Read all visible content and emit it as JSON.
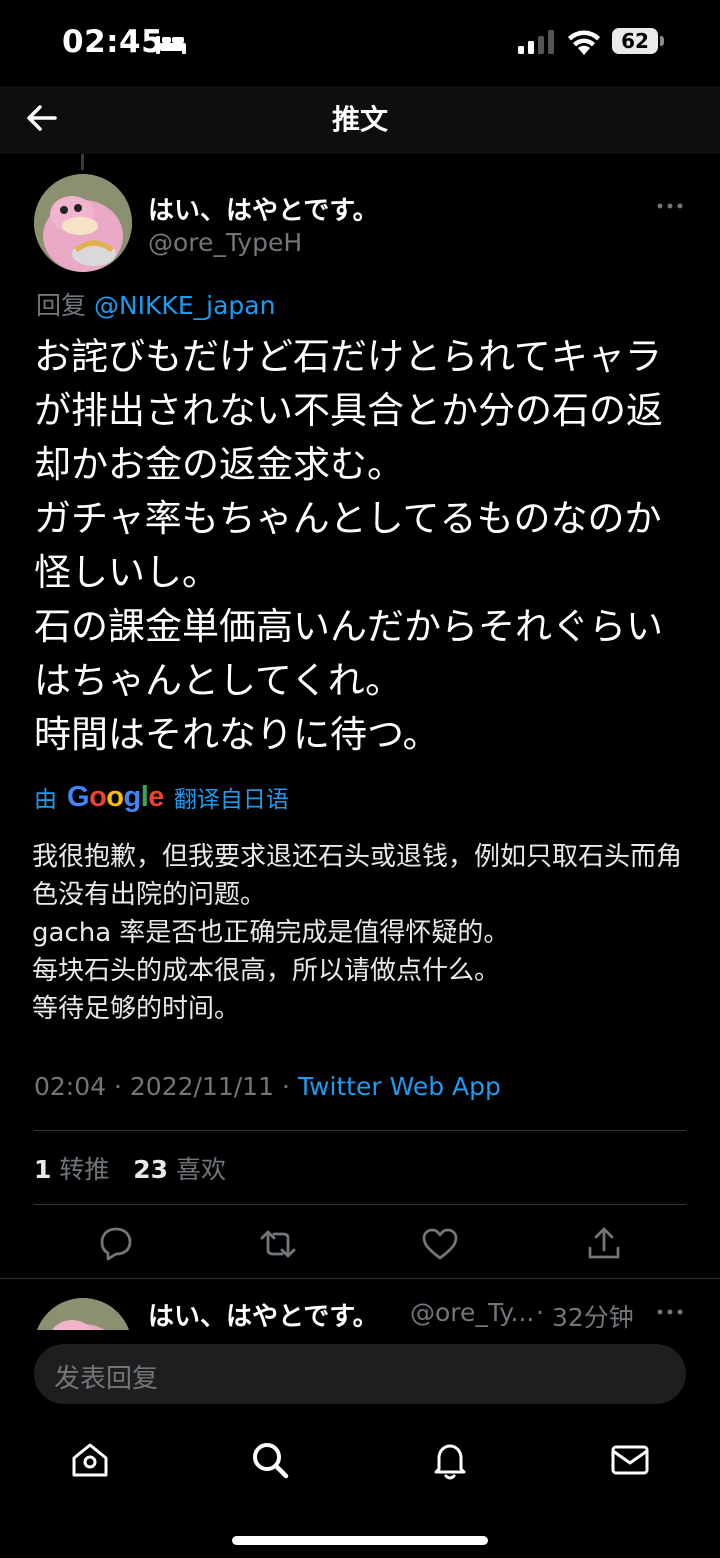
{
  "status_bar": {
    "time": "02:45",
    "battery": "62"
  },
  "header": {
    "title": "推文"
  },
  "tweet": {
    "author_name": "はい、はやとです。",
    "author_handle": "@ore_TypeH",
    "reply_prefix": "回复",
    "reply_to": "@NIKKE_japan",
    "text": "お詫びもだけど石だけとられてキャラが排出されない不具合とか分の石の返却かお金の返金求む。\nガチャ率もちゃんとしてるものなのか怪しいし。\n石の課金単価高いんだからそれぐらいはちゃんとしてくれ。\n時間はそれなりに待つ。",
    "translate_by": "由",
    "translate_brand": "Google",
    "translate_from": "翻译自日语",
    "translated_text": "我很抱歉，但我要求退还石头或退钱，例如只取石头而角色没有出院的问题。\ngacha 率是否也正确完成是值得怀疑的。\n每块石头的成本很高，所以请做点什么。\n等待足够的时间。",
    "time": "02:04",
    "date": "2022/11/11",
    "source": "Twitter Web App",
    "retweets": "1",
    "retweets_label": "转推",
    "likes": "23",
    "likes_label": "喜欢"
  },
  "next_reply": {
    "author_name": "はい、はやとです。",
    "author_handle": "@ore_Ty...",
    "age": "32分钟"
  },
  "compose": {
    "placeholder": "发表回复"
  },
  "icons": {
    "back": "arrow-left-icon",
    "more": "more-dots-icon",
    "reply": "reply-icon",
    "retweet": "retweet-icon",
    "like": "heart-icon",
    "share": "share-icon",
    "home": "home-icon",
    "search": "search-icon",
    "notifications": "bell-icon",
    "messages": "mail-icon"
  },
  "colors": {
    "accent": "#1d9bf0",
    "muted": "#71767b",
    "background": "#000000"
  }
}
